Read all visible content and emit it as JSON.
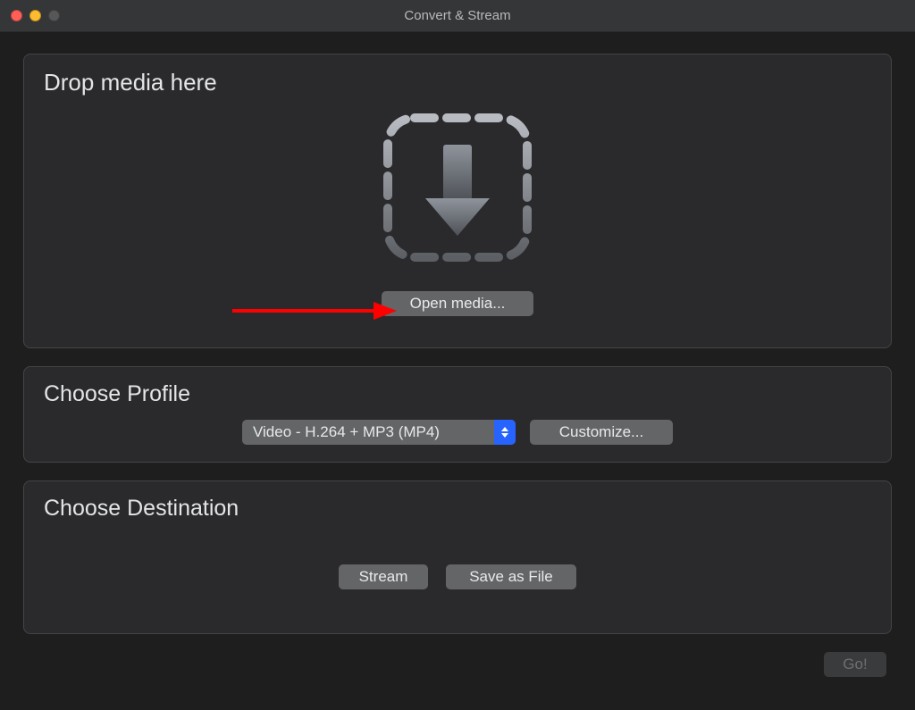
{
  "window": {
    "title": "Convert & Stream"
  },
  "drop": {
    "heading": "Drop media here",
    "open_media_label": "Open media..."
  },
  "profile": {
    "heading": "Choose Profile",
    "selected": "Video - H.264 + MP3 (MP4)",
    "customize_label": "Customize..."
  },
  "destination": {
    "heading": "Choose Destination",
    "stream_label": "Stream",
    "save_as_file_label": "Save as File"
  },
  "footer": {
    "go_label": "Go!"
  },
  "annotation": {
    "arrow_color": "#ff0000"
  }
}
